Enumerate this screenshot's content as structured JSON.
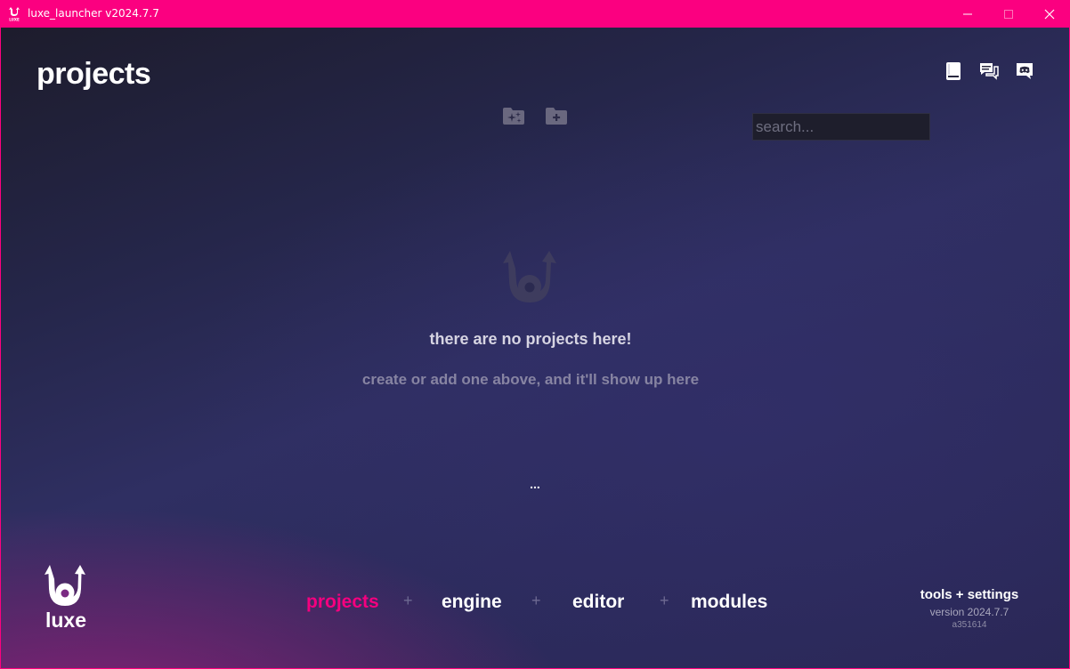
{
  "window": {
    "title": "luxe_launcher v2024.7.7",
    "minimize_glyph": "—",
    "maximize_glyph": "☐",
    "close_glyph": "✕"
  },
  "header": {
    "title": "projects",
    "icons": [
      "book-icon",
      "forum-chat-icon",
      "discord-icon"
    ]
  },
  "toolbar": {
    "new_project_icon": "folder-sparkle-icon",
    "add_project_icon": "folder-plus-icon"
  },
  "search": {
    "placeholder": "search...",
    "value": ""
  },
  "empty_state": {
    "title": "there are no projects here!",
    "subtitle": "create or add one above, and it'll show up here",
    "ellipsis": "..."
  },
  "brand": {
    "name": "luxe"
  },
  "nav": {
    "items": [
      {
        "label": "projects",
        "active": true
      },
      {
        "label": "engine",
        "active": false
      },
      {
        "label": "editor",
        "active": false
      },
      {
        "label": "modules",
        "active": false
      }
    ],
    "separator": "+"
  },
  "footer": {
    "tools_label": "tools + settings",
    "version": "version 2024.7.7",
    "hash": "a351614"
  },
  "colors": {
    "accent": "#fb0080",
    "active_nav": "#f5007f",
    "background_dark": "#1d1c2c",
    "background_purple": "#2f2f62"
  }
}
